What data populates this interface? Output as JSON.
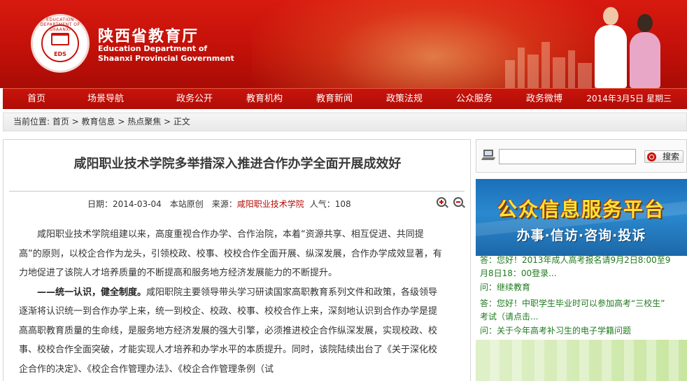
{
  "header": {
    "title_cn": "陕西省教育厅",
    "title_en_line1": "Education Department of",
    "title_en_line2": "Shaanxi Provincial Government",
    "emblem_label": "EDS",
    "emblem_ring": "EDUCATION DEPARTMENT OF SHAANXI"
  },
  "nav": {
    "items": [
      "首页",
      "场景导航",
      "政务公开",
      "教育机构",
      "教育新闻",
      "政策法规",
      "公众服务",
      "政务微博"
    ],
    "date": "2014年3月5日 星期三"
  },
  "breadcrumb": {
    "text": "当前位置: 首页 > 教育信息 > 热点聚焦 > 正文"
  },
  "article": {
    "title": "咸阳职业技术学院多举措深入推进合作办学全面开展成效好",
    "meta_prefix": "日期：2014-03-04　本站原创　来源：",
    "source": "咸阳职业技术学院",
    "hits": "人气：108",
    "para1": "咸阳职业技术学院组建以来，高度重视合作办学、合作治院，本着“资源共享、相互促进、共同提高”的原则，以校企合作为龙头，引领校政、校事、校校合作全面开展、纵深发展，合作办学成效显著，有力地促进了该院人才培养质量的不断提高和服务地方经济发展能力的不断提升。",
    "para2_bold": "——统一认识，健全制度。",
    "para2": "咸阳职院主要领导带头学习研读国家高职教育系列文件和政策，各级领导逐渐将认识统一到合作办学上来，统一到校企、校政、校事、校校合作上来，深刻地认识到合作办学是提高高职教育质量的生命线，是服务地方经济发展的强大引擎，必须推进校企合作纵深发展，实现校政、校事、校校合作全面突破，才能实现人才培养和办学水平的本质提升。同时，该院陆续出台了《关于深化校企合作的决定》、《校企合作管理办法》、《校企合作管理条例（试"
  },
  "sidebar": {
    "search_button": "搜索",
    "search_value": "",
    "banner_title": "公众信息服务平台",
    "banner_sub": "办事·信访·咨询·投诉",
    "qa": [
      "答：您好！2013年成人高考报名请9月2日8:00至9",
      "月8日18：00登录...",
      "问：继续教育",
      "答：您好！中职学生毕业时可以参加高考“三校生”",
      "考试（请点击...",
      "问：关于今年高考补习生的电子学籍问题"
    ]
  },
  "colors": {
    "brand_red": "#c8140c",
    "link_green": "#1f7a1f",
    "banner_blue": "#1a6fb8"
  }
}
